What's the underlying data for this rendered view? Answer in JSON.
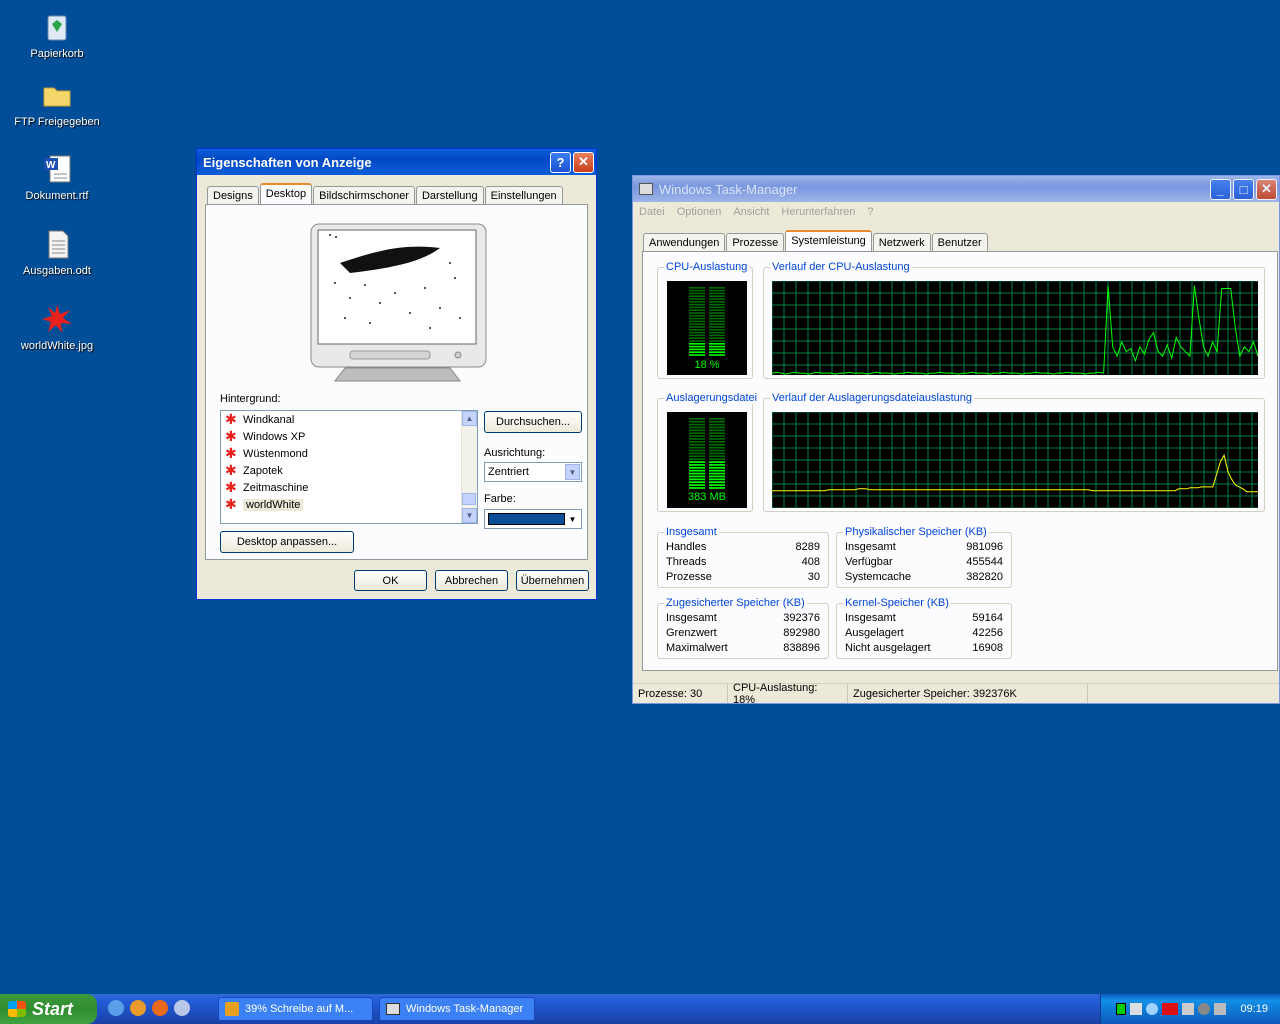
{
  "desktop": {
    "icons": [
      {
        "label": "Papierkorb"
      },
      {
        "label": "FTP Freigegeben"
      },
      {
        "label": "Dokument.rtf"
      },
      {
        "label": "Ausgaben.odt"
      },
      {
        "label": "worldWhite.jpg"
      }
    ]
  },
  "display_dialog": {
    "title": "Eigenschaften von Anzeige",
    "help": "?",
    "close": "✕",
    "tabs": [
      "Designs",
      "Desktop",
      "Bildschirmschoner",
      "Darstellung",
      "Einstellungen"
    ],
    "active_tab": "Desktop",
    "background_label": "Hintergrund:",
    "backgrounds": [
      "Windkanal",
      "Windows XP",
      "Wüstenmond",
      "Zapotek",
      "Zeitmaschine",
      "worldWhite"
    ],
    "selected_background": "worldWhite",
    "browse_button": "Durchsuchen...",
    "alignment_label": "Ausrichtung:",
    "alignment_value": "Zentriert",
    "color_label": "Farbe:",
    "color_value": "#0a4e98",
    "customize_button": "Desktop anpassen...",
    "ok_button": "OK",
    "cancel_button": "Abbrechen",
    "apply_button": "Übernehmen"
  },
  "task_manager": {
    "title": "Windows Task-Manager",
    "minimize": "_",
    "maximize": "□",
    "close": "✕",
    "menu": [
      "Datei",
      "Optionen",
      "Ansicht",
      "Herunterfahren",
      "?"
    ],
    "tabs": [
      "Anwendungen",
      "Prozesse",
      "Systemleistung",
      "Netzwerk",
      "Benutzer"
    ],
    "active_tab": "Systemleistung",
    "cpu_usage_title": "CPU-Auslastung",
    "cpu_usage_value": "18 %",
    "cpu_usage_fraction": 0.18,
    "cpu_history_title": "Verlauf der CPU-Auslastung",
    "pagefile_title": "Auslagerungsdatei",
    "pagefile_value": "383 MB",
    "pagefile_fraction": 0.39,
    "pagefile_history_title": "Verlauf der Auslagerungsdateiauslastung",
    "totals": {
      "title": "Insgesamt",
      "rows": [
        [
          "Handles",
          "8289"
        ],
        [
          "Threads",
          "408"
        ],
        [
          "Prozesse",
          "30"
        ]
      ]
    },
    "physical": {
      "title": "Physikalischer Speicher (KB)",
      "rows": [
        [
          "Insgesamt",
          "981096"
        ],
        [
          "Verfügbar",
          "455544"
        ],
        [
          "Systemcache",
          "382820"
        ]
      ]
    },
    "commit": {
      "title": "Zugesicherter Speicher (KB)",
      "rows": [
        [
          "Insgesamt",
          "392376"
        ],
        [
          "Grenzwert",
          "892980"
        ],
        [
          "Maximalwert",
          "838896"
        ]
      ]
    },
    "kernel": {
      "title": "Kernel-Speicher (KB)",
      "rows": [
        [
          "Insgesamt",
          "59164"
        ],
        [
          "Ausgelagert",
          "42256"
        ],
        [
          "Nicht ausgelagert",
          "16908"
        ]
      ]
    },
    "status": {
      "processes": "Prozesse: 30",
      "cpu": "CPU-Auslastung: 18%",
      "commit": "Zugesicherter Speicher: 392376K"
    },
    "cpu_history": [
      2,
      3,
      2,
      1,
      2,
      3,
      2,
      2,
      1,
      2,
      3,
      2,
      2,
      2,
      1,
      2,
      2,
      3,
      2,
      2,
      2,
      1,
      2,
      3,
      2,
      2,
      2,
      1,
      2,
      2,
      3,
      2,
      2,
      2,
      1,
      2,
      2,
      3,
      2,
      2,
      2,
      1,
      2,
      2,
      3,
      2,
      2,
      2,
      1,
      2,
      2,
      3,
      2,
      2,
      2,
      1,
      2,
      2,
      3,
      2,
      2,
      2,
      1,
      2,
      2,
      3,
      2,
      2,
      2,
      1,
      2,
      2,
      3,
      2,
      95,
      30,
      20,
      35,
      25,
      28,
      15,
      30,
      22,
      38,
      45,
      25,
      20,
      32,
      18,
      40,
      30,
      25,
      20,
      95,
      60,
      30,
      20,
      35,
      25,
      92,
      92,
      92,
      50,
      20,
      30,
      25,
      35,
      20
    ],
    "pagefile_history": [
      18,
      18,
      18,
      18,
      18,
      18,
      18,
      18,
      18,
      18,
      18,
      18,
      18,
      18,
      18,
      19,
      19,
      19,
      19,
      19,
      19,
      19,
      19,
      20,
      20,
      20,
      19,
      19,
      19,
      19,
      19,
      19,
      19,
      19,
      19,
      19,
      19,
      19,
      19,
      19,
      19,
      19,
      19,
      19,
      19,
      19,
      19,
      19,
      19,
      19,
      19,
      19,
      19,
      19,
      19,
      19,
      19,
      19,
      19,
      19,
      19,
      19,
      19,
      19,
      19,
      19,
      19,
      19,
      19,
      19,
      19,
      19,
      19,
      19,
      19,
      19,
      19,
      19,
      19,
      19,
      19,
      19,
      19,
      19,
      19,
      18,
      18,
      18,
      18,
      18,
      18,
      18,
      18,
      18,
      18,
      18,
      18,
      18,
      18,
      18,
      18,
      18,
      18,
      18,
      18,
      18,
      18,
      18,
      20,
      20,
      20,
      21,
      21,
      21,
      22,
      22,
      22,
      22,
      35,
      48,
      55,
      38,
      30,
      24,
      22,
      20,
      17,
      17,
      17,
      17
    ]
  },
  "taskbar": {
    "start": "Start",
    "tasks": [
      "39% Schreibe auf M...",
      "Windows Task-Manager"
    ],
    "clock": "09:19"
  }
}
